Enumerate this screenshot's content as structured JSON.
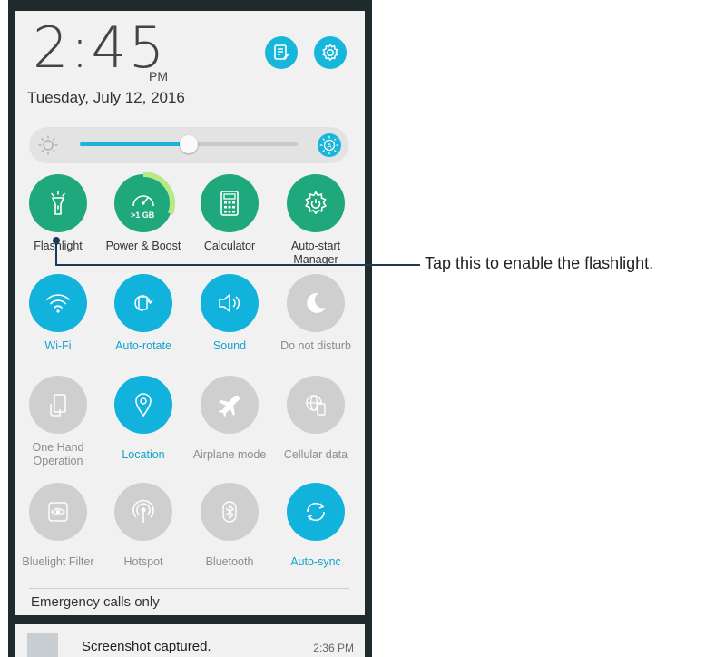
{
  "status": {
    "time_main": "2:45",
    "time_ampm": "PM",
    "date": "Tuesday, July 12, 2016"
  },
  "header_buttons": [
    {
      "name": "notes-button",
      "icon": "notes-edit-icon"
    },
    {
      "name": "settings-button",
      "icon": "gear-icon"
    }
  ],
  "brightness": {
    "level": 0.5,
    "auto_icon": "auto-brightness-icon"
  },
  "tiles": [
    {
      "label": "Flashlight",
      "icon": "flashlight-icon",
      "state": "green"
    },
    {
      "label": "Power & Boost",
      "icon": "speedometer-icon",
      "state": "green",
      "badge": ">1 GB"
    },
    {
      "label": "Calculator",
      "icon": "calculator-icon",
      "state": "green"
    },
    {
      "label": "Auto-start Manager",
      "icon": "gear-power-icon",
      "state": "green"
    },
    {
      "label": "Wi-Fi",
      "icon": "wifi-icon",
      "state": "on"
    },
    {
      "label": "Auto-rotate",
      "icon": "rotate-icon",
      "state": "on"
    },
    {
      "label": "Sound",
      "icon": "speaker-icon",
      "state": "on"
    },
    {
      "label": "Do not disturb",
      "icon": "moon-icon",
      "state": "off"
    },
    {
      "label": "One Hand Operation",
      "icon": "one-hand-icon",
      "state": "off"
    },
    {
      "label": "Location",
      "icon": "location-pin-icon",
      "state": "on"
    },
    {
      "label": "Airplane mode",
      "icon": "airplane-icon",
      "state": "off"
    },
    {
      "label": "Cellular data",
      "icon": "globe-phone-icon",
      "state": "off"
    },
    {
      "label": "Bluelight Filter",
      "icon": "eye-filter-icon",
      "state": "off"
    },
    {
      "label": "Hotspot",
      "icon": "hotspot-icon",
      "state": "off"
    },
    {
      "label": "Bluetooth",
      "icon": "bluetooth-icon",
      "state": "off"
    },
    {
      "label": "Auto-sync",
      "icon": "sync-icon",
      "state": "on"
    }
  ],
  "emergency_text": "Emergency calls only",
  "notification": {
    "text": "Screenshot captured.",
    "time": "2:36 PM"
  },
  "callout": {
    "text": "Tap this to enable the flashlight."
  },
  "colors": {
    "accent_blue": "#11b3dc",
    "green": "#1fa87b",
    "disabled": "#cfcfcf",
    "panel": "#f1f1f1",
    "frame": "#1e2a2c"
  }
}
